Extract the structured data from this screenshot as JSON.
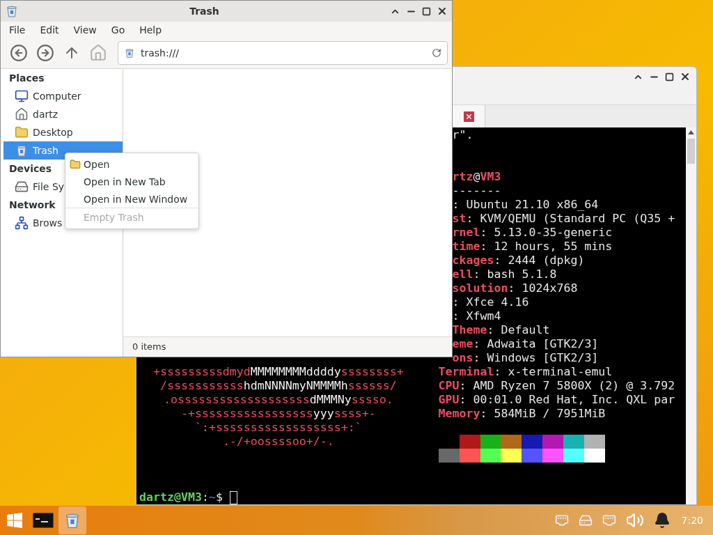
{
  "file_manager": {
    "title": "Trash",
    "menu": [
      "File",
      "Edit",
      "View",
      "Go",
      "Help"
    ],
    "toolbar": [
      {
        "kind": "back",
        "disabled": false
      },
      {
        "kind": "forward",
        "disabled": false
      },
      {
        "kind": "up",
        "disabled": false
      },
      {
        "kind": "home",
        "disabled": true
      }
    ],
    "location": "trash:///",
    "sidebar": [
      {
        "heading": "Places",
        "items": [
          {
            "label": "Computer",
            "kind": "computer",
            "selected": false
          },
          {
            "label": "dartz",
            "kind": "home",
            "selected": false
          },
          {
            "label": "Desktop",
            "kind": "desktop",
            "selected": false
          },
          {
            "label": "Trash",
            "kind": "trash",
            "selected": true
          }
        ]
      },
      {
        "heading": "Devices",
        "items": [
          {
            "label": "File Sy",
            "kind": "drive",
            "selected": false
          }
        ]
      },
      {
        "heading": "Network",
        "items": [
          {
            "label": "Brows",
            "kind": "network",
            "selected": false
          }
        ]
      }
    ],
    "status": "0 items"
  },
  "context_menu": [
    {
      "kind": "item",
      "label": "Open",
      "icon": true,
      "disabled": false
    },
    {
      "kind": "item",
      "label": "Open in New Tab",
      "icon": false,
      "disabled": false
    },
    {
      "kind": "item",
      "label": "Open in New Window",
      "icon": false,
      "disabled": false
    },
    {
      "kind": "separator"
    },
    {
      "kind": "item",
      "label": "Empty Trash",
      "icon": false,
      "disabled": true
    }
  ],
  "terminal": {
    "lines": [
      {
        "kind": "text",
        "cut": true,
        "info": [
          {
            "text": "r\".",
            "bold": false
          }
        ]
      },
      {
        "kind": "blank"
      },
      {
        "kind": "blank"
      },
      {
        "kind": "text",
        "cut": true,
        "info": [
          {
            "text": "rtz",
            "color": "#ea4f62",
            "bold": true
          },
          {
            "text": "@",
            "color": "#e6e6e6",
            "bold": false
          },
          {
            "text": "VM3",
            "color": "#ea4f62",
            "bold": true
          }
        ]
      },
      {
        "kind": "text",
        "cut": true,
        "info": [
          {
            "text": "-------",
            "color": "#e6e6e6",
            "bold": false
          }
        ]
      },
      {
        "kind": "text",
        "cut": true,
        "info": [
          {
            "text": ": Ubuntu 21.10 x86_64",
            "color": "#e6e6e6",
            "bold": false
          }
        ]
      },
      {
        "kind": "text",
        "cut": true,
        "info": [
          {
            "text": "st",
            "color": "#ea4f62",
            "bold": true
          },
          {
            "text": ": KVM/QEMU (Standard PC (Q35 +",
            "color": "#e6e6e6",
            "bold": false
          }
        ]
      },
      {
        "kind": "text",
        "cut": true,
        "info": [
          {
            "text": "rnel",
            "color": "#ea4f62",
            "bold": true
          },
          {
            "text": ": 5.13.0-35-generic",
            "color": "#e6e6e6",
            "bold": false
          }
        ]
      },
      {
        "kind": "text",
        "cut": true,
        "info": [
          {
            "text": "time",
            "color": "#ea4f62",
            "bold": true
          },
          {
            "text": ": 12 hours, 55 mins",
            "color": "#e6e6e6",
            "bold": false
          }
        ]
      },
      {
        "kind": "text",
        "cut": true,
        "info": [
          {
            "text": "ckages",
            "color": "#ea4f62",
            "bold": true
          },
          {
            "text": ": 2444 (dpkg)",
            "color": "#e6e6e6",
            "bold": false
          }
        ]
      },
      {
        "kind": "text",
        "cut": true,
        "info": [
          {
            "text": "ell",
            "color": "#ea4f62",
            "bold": true
          },
          {
            "text": ": bash 5.1.8",
            "color": "#e6e6e6",
            "bold": false
          }
        ]
      },
      {
        "kind": "text",
        "cut": true,
        "info": [
          {
            "text": "solution",
            "color": "#ea4f62",
            "bold": true
          },
          {
            "text": ": 1024x768",
            "color": "#e6e6e6",
            "bold": false
          }
        ]
      },
      {
        "kind": "text",
        "cut": true,
        "info": [
          {
            "text": ": Xfce 4.16",
            "color": "#e6e6e6",
            "bold": false
          }
        ]
      },
      {
        "kind": "text",
        "cut": true,
        "info": [
          {
            "text": ": Xfwm4",
            "color": "#e6e6e6",
            "bold": false
          }
        ]
      },
      {
        "kind": "text",
        "cut": true,
        "info": [
          {
            "text": "Theme",
            "color": "#ea4f62",
            "bold": true
          },
          {
            "text": ": Default",
            "color": "#e6e6e6",
            "bold": false
          }
        ]
      },
      {
        "kind": "text",
        "cut": true,
        "info": [
          {
            "text": "eme",
            "color": "#ea4f62",
            "bold": true
          },
          {
            "text": ": Adwaita [GTK2/3]",
            "color": "#e6e6e6",
            "bold": false
          }
        ]
      },
      {
        "kind": "text",
        "cut": true,
        "info": [
          {
            "text": "ons",
            "color": "#ea4f62",
            "bold": true
          },
          {
            "text": ": Windows [GTK2/3]",
            "color": "#e6e6e6",
            "bold": false
          }
        ]
      },
      {
        "kind": "text",
        "cut": false,
        "art": [
          {
            "text": "+sssssssssdm",
            "color": "#ea4f62",
            "bold": false
          },
          {
            "text": "yd",
            "color": "#ea4f62",
            "bold": false
          },
          {
            "text": "MMMMMMMMddddy",
            "color": "#f2f2f2",
            "bold": false
          },
          {
            "text": "ssssssss+",
            "color": "#ea4f62",
            "bold": false
          }
        ],
        "info": [
          {
            "text": "Terminal",
            "color": "#ea4f62",
            "bold": true
          },
          {
            "text": ": x-terminal-emul",
            "color": "#e6e6e6",
            "bold": false
          }
        ]
      },
      {
        "kind": "text",
        "cut": false,
        "art": [
          {
            "text": "/sssssssssss",
            "color": "#ea4f62",
            "bold": false
          },
          {
            "text": "hdmNNNNmyNMMMMh",
            "color": "#f2f2f2",
            "bold": false
          },
          {
            "text": "ssssss/",
            "color": "#ea4f62",
            "bold": false
          }
        ],
        "info": [
          {
            "text": "CPU",
            "color": "#ea4f62",
            "bold": true
          },
          {
            "text": ": AMD Ryzen 7 5800X (2) @ 3.792",
            "color": "#e6e6e6",
            "bold": false
          }
        ]
      },
      {
        "kind": "text",
        "cut": false,
        "art": [
          {
            "text": ".osssssssssssssssssss",
            "color": "#ea4f62",
            "bold": false
          },
          {
            "text": "dMMMNy",
            "color": "#f2f2f2",
            "bold": false
          },
          {
            "text": "sssso.",
            "color": "#ea4f62",
            "bold": false
          }
        ],
        "info": [
          {
            "text": "GPU",
            "color": "#ea4f62",
            "bold": true
          },
          {
            "text": ": 00:01.0 Red Hat, Inc. QXL par",
            "color": "#e6e6e6",
            "bold": false
          }
        ]
      },
      {
        "kind": "text",
        "cut": false,
        "art": [
          {
            "text": "-+sssssssssssssssss",
            "color": "#ea4f62",
            "bold": false
          },
          {
            "text": "yyy",
            "color": "#f2f2f2",
            "bold": false
          },
          {
            "text": "ssss+-",
            "color": "#ea4f62",
            "bold": false
          }
        ],
        "info": [
          {
            "text": "Memory",
            "color": "#ea4f62",
            "bold": true
          },
          {
            "text": ": 584MiB / 7951MiB",
            "color": "#e6e6e6",
            "bold": false
          }
        ]
      },
      {
        "kind": "text",
        "art": [
          {
            "text": "`:+ssssssssssssssssss+:`",
            "color": "#ea4f62",
            "bold": false
          }
        ]
      },
      {
        "kind": "text",
        "art": [
          {
            "text": ".-/+oossssoo+/-.",
            "color": "#ea4f62",
            "bold": false
          }
        ],
        "swatches": [
          {
            "color": "#b21818"
          },
          {
            "color": "#18b218"
          },
          {
            "color": "#b26818"
          },
          {
            "color": "#1818b2"
          },
          {
            "color": "#b218b2"
          },
          {
            "color": "#18b2b2"
          },
          {
            "color": "#b2b2b2"
          }
        ]
      },
      {
        "kind": "text",
        "swatches": [
          {
            "color": "#686868"
          },
          {
            "color": "#ff5454"
          },
          {
            "color": "#54ff54"
          },
          {
            "color": "#ffff54"
          },
          {
            "color": "#5454ff"
          },
          {
            "color": "#ff54ff"
          },
          {
            "color": "#54ffff"
          },
          {
            "color": "#ffffff"
          }
        ]
      },
      {
        "kind": "blank"
      },
      {
        "kind": "blank"
      },
      {
        "kind": "prompt",
        "info": [
          {
            "text": "dartz@VM3",
            "color": "#5fd35f",
            "bold": true
          },
          {
            "text": ":",
            "color": "#e6e6e6",
            "bold": false
          },
          {
            "text": "~",
            "color": "#5c7cff",
            "bold": false
          },
          {
            "text": "$",
            "color": "#e6e6e6",
            "bold": false
          }
        ]
      }
    ]
  },
  "taskbar": {
    "tasks": [
      {
        "kind": "terminal",
        "active": false
      },
      {
        "kind": "trash",
        "active": true
      }
    ],
    "clock": "7:20"
  }
}
